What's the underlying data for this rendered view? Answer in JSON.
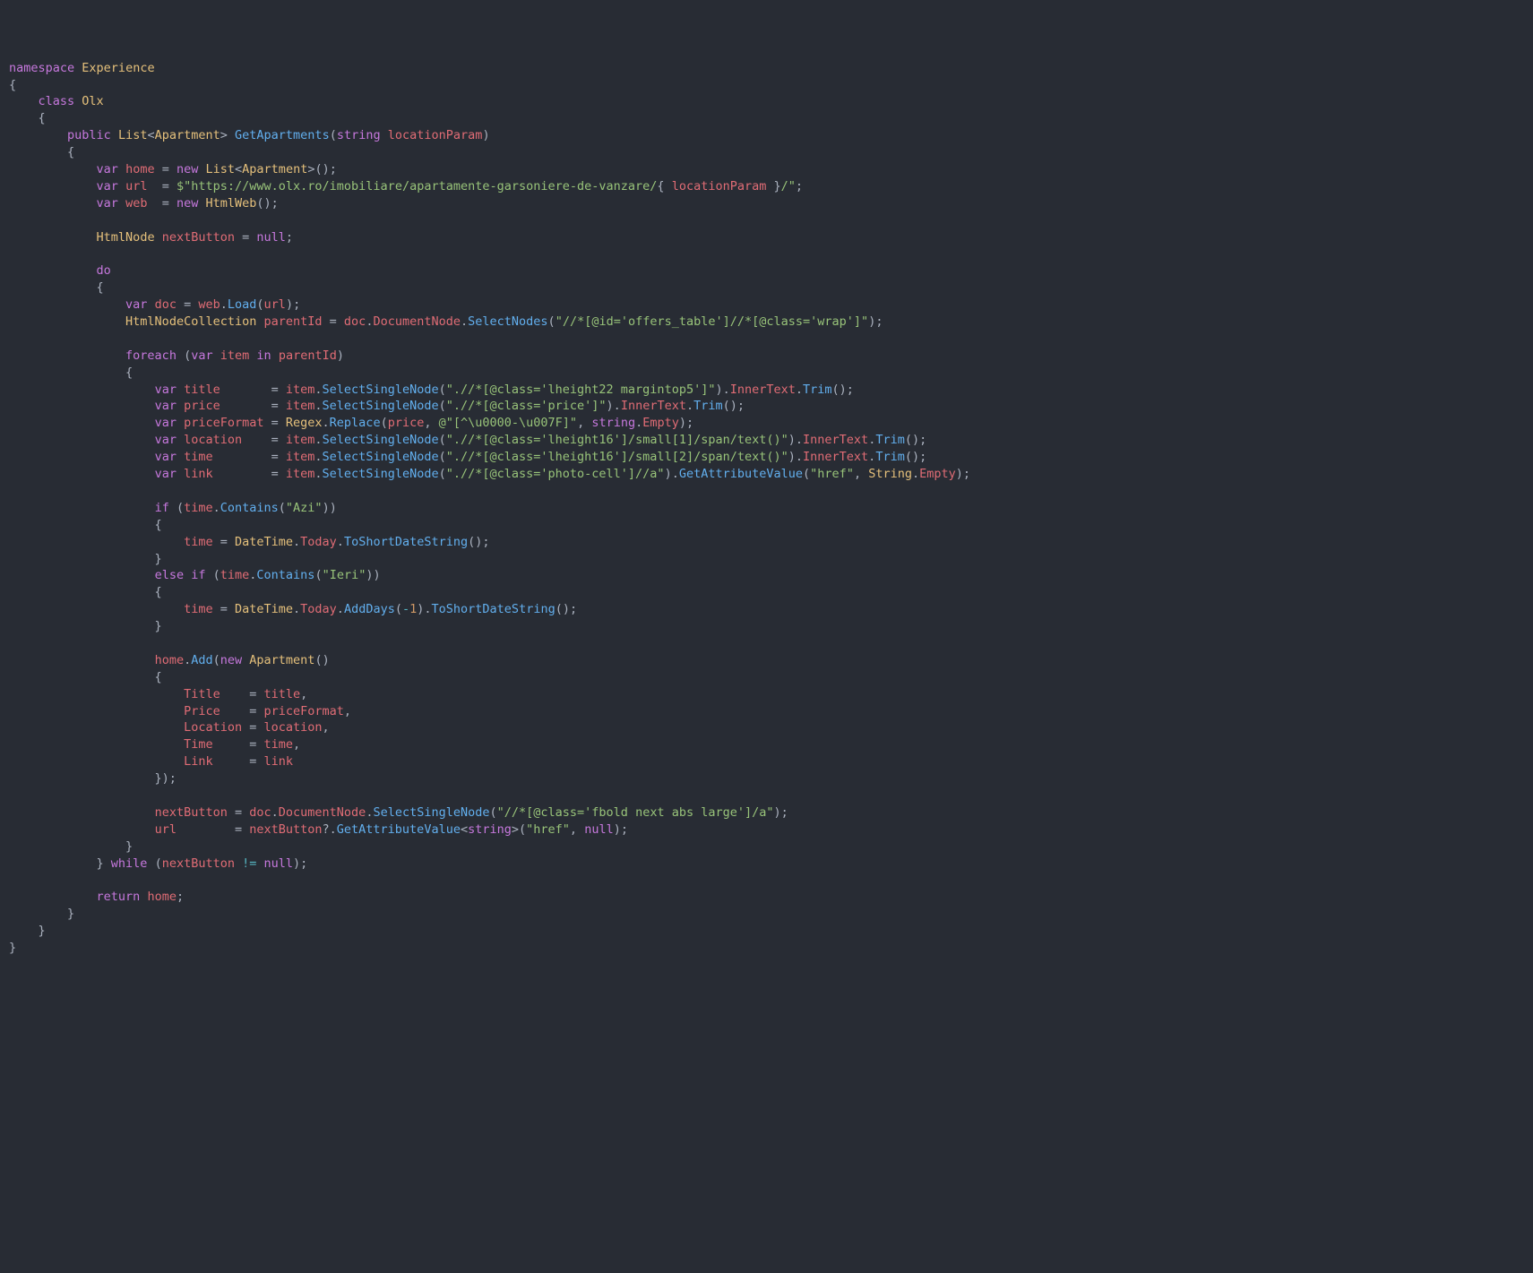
{
  "tokens": [
    [
      [
        "kw",
        "namespace"
      ],
      [
        "p",
        " "
      ],
      [
        "name",
        "Experience"
      ]
    ],
    [
      [
        "p",
        "{"
      ]
    ],
    [
      [
        "p",
        "    "
      ],
      [
        "kw",
        "class"
      ],
      [
        "p",
        " "
      ],
      [
        "name",
        "Olx"
      ]
    ],
    [
      [
        "p",
        "    {"
      ]
    ],
    [
      [
        "p",
        "        "
      ],
      [
        "kw",
        "public"
      ],
      [
        "p",
        " "
      ],
      [
        "type",
        "List"
      ],
      [
        "p",
        "<"
      ],
      [
        "type",
        "Apartment"
      ],
      [
        "p",
        "> "
      ],
      [
        "fn",
        "GetApartments"
      ],
      [
        "p",
        "("
      ],
      [
        "ptype",
        "string"
      ],
      [
        "p",
        " "
      ],
      [
        "var",
        "locationParam"
      ],
      [
        "p",
        ")"
      ]
    ],
    [
      [
        "p",
        "        {"
      ]
    ],
    [
      [
        "p",
        "            "
      ],
      [
        "kw",
        "var"
      ],
      [
        "p",
        " "
      ],
      [
        "var",
        "home"
      ],
      [
        "p",
        " = "
      ],
      [
        "kw",
        "new"
      ],
      [
        "p",
        " "
      ],
      [
        "type",
        "List"
      ],
      [
        "p",
        "<"
      ],
      [
        "type",
        "Apartment"
      ],
      [
        "p",
        ">();"
      ]
    ],
    [
      [
        "p",
        "            "
      ],
      [
        "kw",
        "var"
      ],
      [
        "p",
        " "
      ],
      [
        "var",
        "url"
      ],
      [
        "p",
        "  = "
      ],
      [
        "str",
        "$\"https://www.olx.ro/imobiliare/apartamente-garsoniere-de-vanzare/"
      ],
      [
        "p",
        "{ "
      ],
      [
        "var",
        "locationParam"
      ],
      [
        "p",
        " }"
      ],
      [
        "str",
        "/\""
      ],
      [
        "p",
        ";"
      ]
    ],
    [
      [
        "p",
        "            "
      ],
      [
        "kw",
        "var"
      ],
      [
        "p",
        " "
      ],
      [
        "var",
        "web"
      ],
      [
        "p",
        "  = "
      ],
      [
        "kw",
        "new"
      ],
      [
        "p",
        " "
      ],
      [
        "type",
        "HtmlWeb"
      ],
      [
        "p",
        "();"
      ]
    ],
    [
      [
        "p",
        ""
      ]
    ],
    [
      [
        "p",
        "            "
      ],
      [
        "type",
        "HtmlNode"
      ],
      [
        "p",
        " "
      ],
      [
        "var",
        "nextButton"
      ],
      [
        "p",
        " = "
      ],
      [
        "kw",
        "null"
      ],
      [
        "p",
        ";"
      ]
    ],
    [
      [
        "p",
        ""
      ]
    ],
    [
      [
        "p",
        "            "
      ],
      [
        "kw",
        "do"
      ]
    ],
    [
      [
        "p",
        "            {"
      ]
    ],
    [
      [
        "p",
        "                "
      ],
      [
        "kw",
        "var"
      ],
      [
        "p",
        " "
      ],
      [
        "var",
        "doc"
      ],
      [
        "p",
        " = "
      ],
      [
        "var",
        "web"
      ],
      [
        "p",
        "."
      ],
      [
        "fn",
        "Load"
      ],
      [
        "p",
        "("
      ],
      [
        "var",
        "url"
      ],
      [
        "p",
        ");"
      ]
    ],
    [
      [
        "p",
        "                "
      ],
      [
        "type",
        "HtmlNodeCollection"
      ],
      [
        "p",
        " "
      ],
      [
        "var",
        "parentId"
      ],
      [
        "p",
        " = "
      ],
      [
        "var",
        "doc"
      ],
      [
        "p",
        "."
      ],
      [
        "var",
        "DocumentNode"
      ],
      [
        "p",
        "."
      ],
      [
        "fn",
        "SelectNodes"
      ],
      [
        "p",
        "("
      ],
      [
        "str",
        "\"//*[@id='offers_table']//*[@class='wrap']\""
      ],
      [
        "p",
        ");"
      ]
    ],
    [
      [
        "p",
        ""
      ]
    ],
    [
      [
        "p",
        "                "
      ],
      [
        "kw",
        "foreach"
      ],
      [
        "p",
        " ("
      ],
      [
        "kw",
        "var"
      ],
      [
        "p",
        " "
      ],
      [
        "var",
        "item"
      ],
      [
        "p",
        " "
      ],
      [
        "kw",
        "in"
      ],
      [
        "p",
        " "
      ],
      [
        "var",
        "parentId"
      ],
      [
        "p",
        ")"
      ]
    ],
    [
      [
        "p",
        "                {"
      ]
    ],
    [
      [
        "p",
        "                    "
      ],
      [
        "kw",
        "var"
      ],
      [
        "p",
        " "
      ],
      [
        "var",
        "title"
      ],
      [
        "p",
        "       = "
      ],
      [
        "var",
        "item"
      ],
      [
        "p",
        "."
      ],
      [
        "fn",
        "SelectSingleNode"
      ],
      [
        "p",
        "("
      ],
      [
        "str",
        "\".//*[@class='lheight22 margintop5']\""
      ],
      [
        "p",
        ")."
      ],
      [
        "var",
        "InnerText"
      ],
      [
        "p",
        "."
      ],
      [
        "fn",
        "Trim"
      ],
      [
        "p",
        "();"
      ]
    ],
    [
      [
        "p",
        "                    "
      ],
      [
        "kw",
        "var"
      ],
      [
        "p",
        " "
      ],
      [
        "var",
        "price"
      ],
      [
        "p",
        "       = "
      ],
      [
        "var",
        "item"
      ],
      [
        "p",
        "."
      ],
      [
        "fn",
        "SelectSingleNode"
      ],
      [
        "p",
        "("
      ],
      [
        "str",
        "\".//*[@class='price']\""
      ],
      [
        "p",
        ")."
      ],
      [
        "var",
        "InnerText"
      ],
      [
        "p",
        "."
      ],
      [
        "fn",
        "Trim"
      ],
      [
        "p",
        "();"
      ]
    ],
    [
      [
        "p",
        "                    "
      ],
      [
        "kw",
        "var"
      ],
      [
        "p",
        " "
      ],
      [
        "var",
        "priceFormat"
      ],
      [
        "p",
        " = "
      ],
      [
        "type",
        "Regex"
      ],
      [
        "p",
        "."
      ],
      [
        "fn",
        "Replace"
      ],
      [
        "p",
        "("
      ],
      [
        "var",
        "price"
      ],
      [
        "p",
        ", "
      ],
      [
        "str",
        "@\"[^\\u0000-\\u007F]\""
      ],
      [
        "p",
        ", "
      ],
      [
        "ptype",
        "string"
      ],
      [
        "p",
        "."
      ],
      [
        "var",
        "Empty"
      ],
      [
        "p",
        ");"
      ]
    ],
    [
      [
        "p",
        "                    "
      ],
      [
        "kw",
        "var"
      ],
      [
        "p",
        " "
      ],
      [
        "var",
        "location"
      ],
      [
        "p",
        "    = "
      ],
      [
        "var",
        "item"
      ],
      [
        "p",
        "."
      ],
      [
        "fn",
        "SelectSingleNode"
      ],
      [
        "p",
        "("
      ],
      [
        "str",
        "\".//*[@class='lheight16']/small[1]/span/text()\""
      ],
      [
        "p",
        ")."
      ],
      [
        "var",
        "InnerText"
      ],
      [
        "p",
        "."
      ],
      [
        "fn",
        "Trim"
      ],
      [
        "p",
        "();"
      ]
    ],
    [
      [
        "p",
        "                    "
      ],
      [
        "kw",
        "var"
      ],
      [
        "p",
        " "
      ],
      [
        "var",
        "time"
      ],
      [
        "p",
        "        = "
      ],
      [
        "var",
        "item"
      ],
      [
        "p",
        "."
      ],
      [
        "fn",
        "SelectSingleNode"
      ],
      [
        "p",
        "("
      ],
      [
        "str",
        "\".//*[@class='lheight16']/small[2]/span/text()\""
      ],
      [
        "p",
        ")."
      ],
      [
        "var",
        "InnerText"
      ],
      [
        "p",
        "."
      ],
      [
        "fn",
        "Trim"
      ],
      [
        "p",
        "();"
      ]
    ],
    [
      [
        "p",
        "                    "
      ],
      [
        "kw",
        "var"
      ],
      [
        "p",
        " "
      ],
      [
        "var",
        "link"
      ],
      [
        "p",
        "        = "
      ],
      [
        "var",
        "item"
      ],
      [
        "p",
        "."
      ],
      [
        "fn",
        "SelectSingleNode"
      ],
      [
        "p",
        "("
      ],
      [
        "str",
        "\".//*[@class='photo-cell']//a\""
      ],
      [
        "p",
        ")."
      ],
      [
        "fn",
        "GetAttributeValue"
      ],
      [
        "p",
        "("
      ],
      [
        "str",
        "\"href\""
      ],
      [
        "p",
        ", "
      ],
      [
        "type",
        "String"
      ],
      [
        "p",
        "."
      ],
      [
        "var",
        "Empty"
      ],
      [
        "p",
        ");"
      ]
    ],
    [
      [
        "p",
        ""
      ]
    ],
    [
      [
        "p",
        "                    "
      ],
      [
        "kw",
        "if"
      ],
      [
        "p",
        " ("
      ],
      [
        "var",
        "time"
      ],
      [
        "p",
        "."
      ],
      [
        "fn",
        "Contains"
      ],
      [
        "p",
        "("
      ],
      [
        "str",
        "\"Azi\""
      ],
      [
        "p",
        "))"
      ]
    ],
    [
      [
        "p",
        "                    {"
      ]
    ],
    [
      [
        "p",
        "                        "
      ],
      [
        "var",
        "time"
      ],
      [
        "p",
        " = "
      ],
      [
        "type",
        "DateTime"
      ],
      [
        "p",
        "."
      ],
      [
        "var",
        "Today"
      ],
      [
        "p",
        "."
      ],
      [
        "fn",
        "ToShortDateString"
      ],
      [
        "p",
        "();"
      ]
    ],
    [
      [
        "p",
        "                    }"
      ]
    ],
    [
      [
        "p",
        "                    "
      ],
      [
        "kw",
        "else"
      ],
      [
        "p",
        " "
      ],
      [
        "kw",
        "if"
      ],
      [
        "p",
        " ("
      ],
      [
        "var",
        "time"
      ],
      [
        "p",
        "."
      ],
      [
        "fn",
        "Contains"
      ],
      [
        "p",
        "("
      ],
      [
        "str",
        "\"Ieri\""
      ],
      [
        "p",
        "))"
      ]
    ],
    [
      [
        "p",
        "                    {"
      ]
    ],
    [
      [
        "p",
        "                        "
      ],
      [
        "var",
        "time"
      ],
      [
        "p",
        " = "
      ],
      [
        "type",
        "DateTime"
      ],
      [
        "p",
        "."
      ],
      [
        "var",
        "Today"
      ],
      [
        "p",
        "."
      ],
      [
        "fn",
        "AddDays"
      ],
      [
        "p",
        "("
      ],
      [
        "op",
        "-"
      ],
      [
        "num",
        "1"
      ],
      [
        "p",
        ")."
      ],
      [
        "fn",
        "ToShortDateString"
      ],
      [
        "p",
        "();"
      ]
    ],
    [
      [
        "p",
        "                    }"
      ]
    ],
    [
      [
        "p",
        ""
      ]
    ],
    [
      [
        "p",
        "                    "
      ],
      [
        "var",
        "home"
      ],
      [
        "p",
        "."
      ],
      [
        "fn",
        "Add"
      ],
      [
        "p",
        "("
      ],
      [
        "kw",
        "new"
      ],
      [
        "p",
        " "
      ],
      [
        "type",
        "Apartment"
      ],
      [
        "p",
        "()"
      ]
    ],
    [
      [
        "p",
        "                    {"
      ]
    ],
    [
      [
        "p",
        "                        "
      ],
      [
        "prop",
        "Title"
      ],
      [
        "p",
        "    = "
      ],
      [
        "var",
        "title"
      ],
      [
        "p",
        ","
      ]
    ],
    [
      [
        "p",
        "                        "
      ],
      [
        "prop",
        "Price"
      ],
      [
        "p",
        "    = "
      ],
      [
        "var",
        "priceFormat"
      ],
      [
        "p",
        ","
      ]
    ],
    [
      [
        "p",
        "                        "
      ],
      [
        "prop",
        "Location"
      ],
      [
        "p",
        " = "
      ],
      [
        "var",
        "location"
      ],
      [
        "p",
        ","
      ]
    ],
    [
      [
        "p",
        "                        "
      ],
      [
        "prop",
        "Time"
      ],
      [
        "p",
        "     = "
      ],
      [
        "var",
        "time"
      ],
      [
        "p",
        ","
      ]
    ],
    [
      [
        "p",
        "                        "
      ],
      [
        "prop",
        "Link"
      ],
      [
        "p",
        "     = "
      ],
      [
        "var",
        "link"
      ]
    ],
    [
      [
        "p",
        "                    });"
      ]
    ],
    [
      [
        "p",
        ""
      ]
    ],
    [
      [
        "p",
        "                    "
      ],
      [
        "var",
        "nextButton"
      ],
      [
        "p",
        " = "
      ],
      [
        "var",
        "doc"
      ],
      [
        "p",
        "."
      ],
      [
        "var",
        "DocumentNode"
      ],
      [
        "p",
        "."
      ],
      [
        "fn",
        "SelectSingleNode"
      ],
      [
        "p",
        "("
      ],
      [
        "str",
        "\"//*[@class='fbold next abs large']/a\""
      ],
      [
        "p",
        ");"
      ]
    ],
    [
      [
        "p",
        "                    "
      ],
      [
        "var",
        "url"
      ],
      [
        "p",
        "        = "
      ],
      [
        "var",
        "nextButton"
      ],
      [
        "p",
        "?."
      ],
      [
        "fn",
        "GetAttributeValue"
      ],
      [
        "p",
        "<"
      ],
      [
        "ptype",
        "string"
      ],
      [
        "p",
        ">("
      ],
      [
        "str",
        "\"href\""
      ],
      [
        "p",
        ", "
      ],
      [
        "kw",
        "null"
      ],
      [
        "p",
        ");"
      ]
    ],
    [
      [
        "p",
        "                }"
      ]
    ],
    [
      [
        "p",
        "            } "
      ],
      [
        "kw",
        "while"
      ],
      [
        "p",
        " ("
      ],
      [
        "var",
        "nextButton"
      ],
      [
        "p",
        " "
      ],
      [
        "op",
        "!="
      ],
      [
        "p",
        " "
      ],
      [
        "kw",
        "null"
      ],
      [
        "p",
        ");"
      ]
    ],
    [
      [
        "p",
        ""
      ]
    ],
    [
      [
        "p",
        "            "
      ],
      [
        "kw",
        "return"
      ],
      [
        "p",
        " "
      ],
      [
        "var",
        "home"
      ],
      [
        "p",
        ";"
      ]
    ],
    [
      [
        "p",
        "        }"
      ]
    ],
    [
      [
        "p",
        "    }"
      ]
    ],
    [
      [
        "p",
        "}"
      ]
    ]
  ]
}
